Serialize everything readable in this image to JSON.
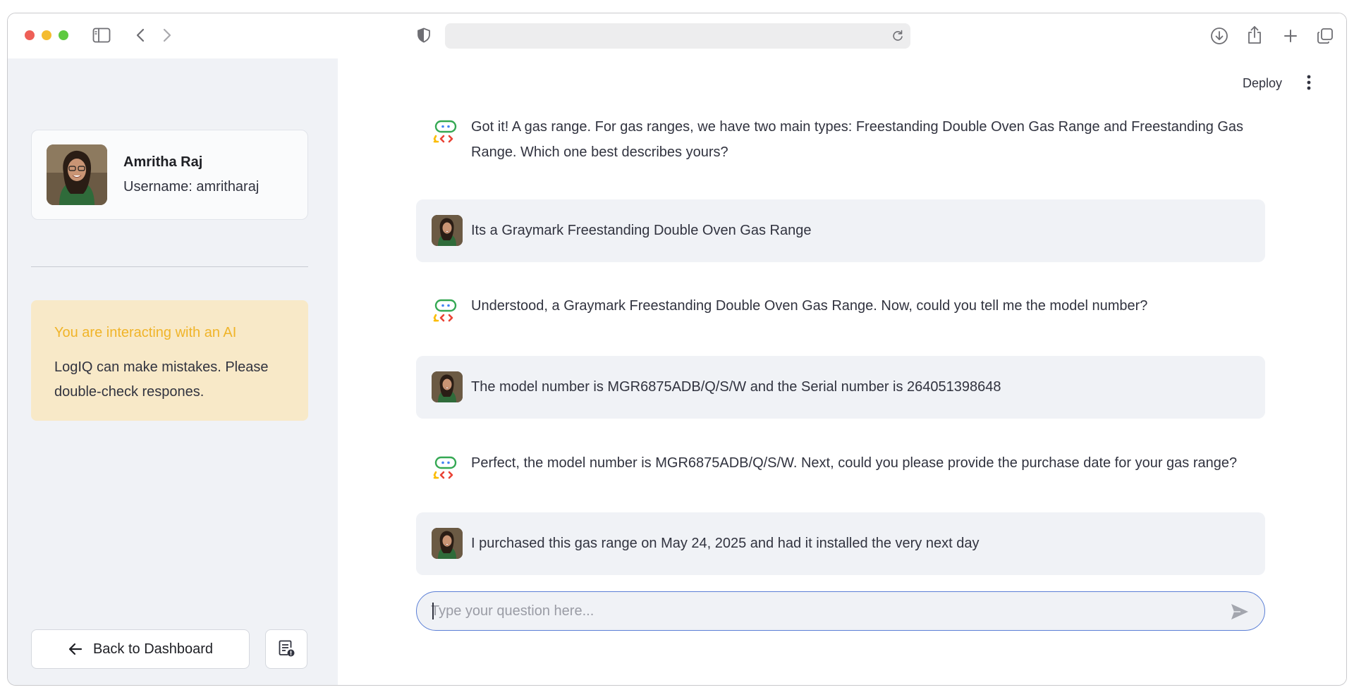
{
  "browser": {
    "address": ""
  },
  "header": {
    "deploy_label": "Deploy"
  },
  "sidebar": {
    "profile": {
      "name": "Amritha Raj",
      "username": "Username: amritharaj"
    },
    "notice": {
      "title": "You are interacting with an AI",
      "body": "LogIQ can make mistakes. Please double-check respones."
    },
    "back_label": "Back to Dashboard"
  },
  "chat": {
    "messages": [
      {
        "role": "assistant",
        "text": "Got it! A gas range. For gas ranges, we have two main types: Freestanding Double Oven Gas Range and Freestanding Gas Range. Which one best describes yours?"
      },
      {
        "role": "user",
        "text": "Its a Graymark Freestanding Double Oven Gas Range"
      },
      {
        "role": "assistant",
        "text": "Understood, a Graymark Freestanding Double Oven Gas Range. Now, could you tell me the model number?"
      },
      {
        "role": "user",
        "text": "The model number is MGR6875ADB/Q/S/W and the Serial number is 264051398648"
      },
      {
        "role": "assistant",
        "text": "Perfect, the model number is MGR6875ADB/Q/S/W. Next, could you please provide the purchase date for your gas range?"
      },
      {
        "role": "user",
        "text": "I purchased this gas range on May 24, 2025 and had it installed the very next day"
      }
    ],
    "input_placeholder": "Type your question here...",
    "input_value": ""
  },
  "colors": {
    "sidebar_bg": "#f0f2f6",
    "notice_bg": "#f8e9c8",
    "notice_title": "#f0b429",
    "input_border": "#5b7fd6",
    "bot_icon_green": "#34a853",
    "bot_icon_blue": "#4285f4",
    "bot_icon_red": "#ea4335",
    "bot_icon_yellow": "#fbbc04"
  },
  "icons": {
    "sidebar_toggle": "sidebar-icon",
    "back": "chevron-left-icon",
    "forward": "chevron-right-icon",
    "privacy": "shield-icon",
    "reload": "reload-icon",
    "download": "download-icon",
    "share": "share-icon",
    "new_tab": "plus-icon",
    "tabs": "tabs-overview-icon",
    "menu": "kebab-menu-icon",
    "report": "report-icon",
    "send": "send-icon",
    "assistant_avatar": "bot-icon"
  }
}
